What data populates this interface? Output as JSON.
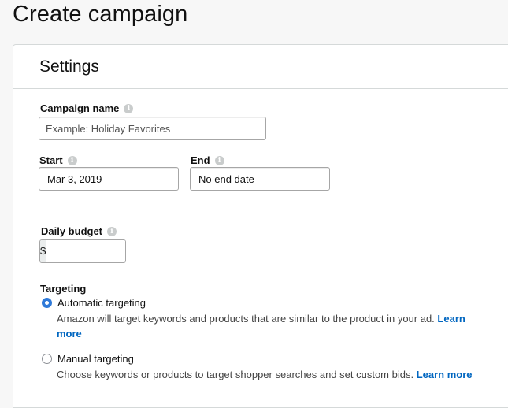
{
  "page": {
    "title": "Create campaign"
  },
  "settings": {
    "title": "Settings",
    "campaign_name": {
      "label": "Campaign name",
      "placeholder": "Example: Holiday Favorites",
      "value": ""
    },
    "start": {
      "label": "Start",
      "value": "Mar 3, 2019"
    },
    "end": {
      "label": "End",
      "value": "No end date"
    },
    "daily_budget": {
      "label": "Daily budget",
      "currency": "$",
      "value": ""
    },
    "targeting": {
      "label": "Targeting",
      "automatic": {
        "label": "Automatic targeting",
        "checked": true,
        "description": "Amazon will target keywords and products that are similar to the product in your ad.",
        "link_part1": "Learn",
        "link_part2": "more"
      },
      "manual": {
        "label": "Manual targeting",
        "checked": false,
        "description": "Choose keywords or products to target shopper searches and set custom bids.",
        "link": "Learn more"
      }
    }
  },
  "colors": {
    "accent": "#2f7ad9",
    "link": "#0066c0",
    "border": "#d5d9d9"
  },
  "icons": {
    "info": "info-circle-icon"
  }
}
